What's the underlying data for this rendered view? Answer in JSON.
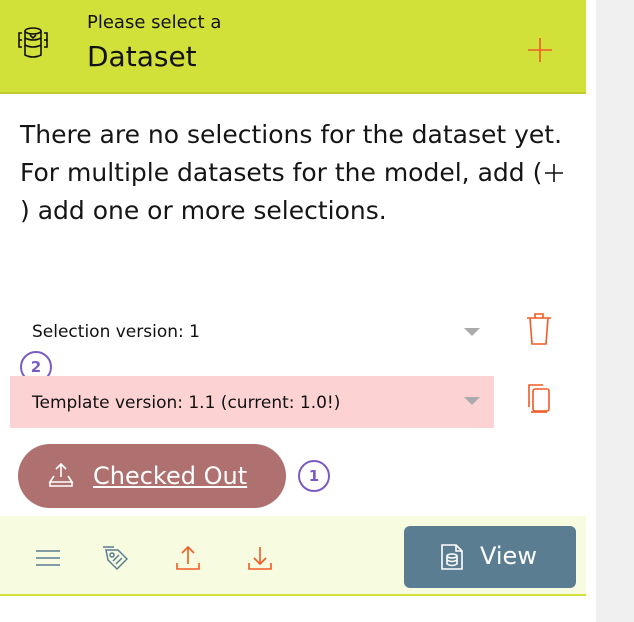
{
  "header": {
    "subtitle": "Please select a",
    "title": "Dataset",
    "icon": "database-icon",
    "add_icon": "plus-icon"
  },
  "info": {
    "text_before": "There are no selections for the dataset yet. For multiple datasets for the model, add (",
    "text_after": ") add one or more selections."
  },
  "selection": {
    "label": "Selection version: 1"
  },
  "template": {
    "label": "Template version: 1.1 (current: 1.0!)"
  },
  "badges": {
    "one": "1",
    "two": "2"
  },
  "checkout": {
    "label": "Checked Out"
  },
  "toolbar": {
    "icons": [
      "menu-icon",
      "tag-icon",
      "upload-icon",
      "download-icon"
    ]
  },
  "view_button": {
    "label": "View"
  },
  "colors": {
    "header_bg": "#d2e03a",
    "accent_orange": "#f05a24",
    "template_row_bg": "#fdd2d2",
    "checkout_bg": "#ae7170",
    "view_bg": "#5a7d92",
    "badge_purple": "#7a5cc4",
    "toolbar_bg": "#f7fbe0"
  }
}
